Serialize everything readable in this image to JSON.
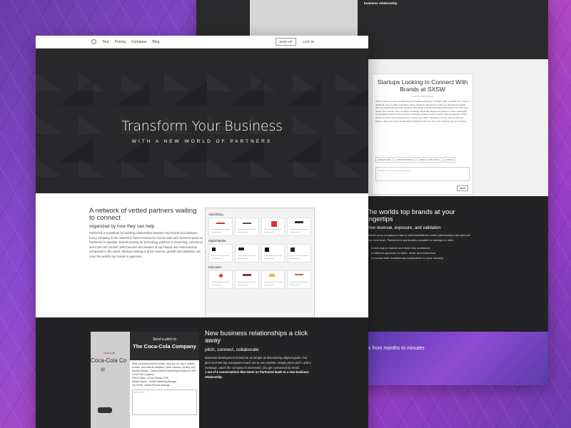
{
  "nav": {
    "items": [
      "Tour",
      "Pricing",
      "Company",
      "Blog"
    ],
    "signup": "SIGN UP",
    "login": "LOG IN"
  },
  "hero": {
    "title": "Transform Your Business",
    "subtitle": "WITH A NEW WORLD OF PARTNERS"
  },
  "network": {
    "heading": "A network of vetted partners waiting to connect",
    "sub": "organized by how they can help",
    "body": "Partnered is a platform for building relationships between top brands and startups. Every company in the network is hand reviewed to ensure that each moment spent on Partnered is valuable. Brands looking for technology partners in marketing, commerce and more can connect with founders and leaders of top funded and vetted startup companies in the world. Startups looking to drive revenue, growth and validation can meet the world's top brands & agencies.",
    "categories": [
      "Advertising",
      "Digital Media",
      "Education"
    ]
  },
  "pitch": {
    "send": "Send a pitch to",
    "company": "The Coca-Cola Company",
    "back_name": "Coca-Cola Co",
    "options": [
      "Most successful pitches include: what you do, why it matters to them, and external validation (other partners, funding, etc)",
      "Rachel Dawson - Global Director Marketing Innovation & The Coca-Cola Company",
      "Peter Collins - Group Director CPE",
      "Natalie Nunez - Global Marketing Manager",
      "Jim White - Global Product Strategy"
    ],
    "placeholder": "Enter here..."
  },
  "biz": {
    "heading": "New business relationships a click away",
    "sub": "pitch, connect, collaborate",
    "body1": "Business development should be as simple as discovering aligned goals. Our pitch tool lets top companies reach out to one another. Simply press pitch, add a message, and if the company is interested, you get connected by email.",
    "body2": "1 out of 4 conversations that starts on Partnered leads to a new business relationship."
  },
  "back": {
    "relationship": "business relationship.",
    "post_title": "Startups Looking to Connect With Brands at SXSW",
    "posted_by": "posted by PARTNERED",
    "post_body": "We're hosting our first ever Partnered \"innovation exchange\" on March 13th at SXSW. The event is designed to be an offline extension of the network in that we'll be setting up structured meetings with top brands and agencies based on their goals. Instead of throwing 300 people in a room and hoping they connect, the innovation exchange will enable aligned companies to have meaningful conversations based on the premise of actually working together. Early confirmed guests include groups of senior level executives from Coca-Cola, GMO, Mondelez, L'Oreal, and Leo Burnett. Reply to this post if you'll be attending SXSW and we'll see how your company can get involved.",
    "tags": [
      "ADVERTISING",
      "ENTERTAINMENT",
      "MEDIA & PUBLISHING",
      "MOBILE"
    ],
    "reply_placeholder": "Explain how we can work together...",
    "send": "SEND",
    "brands_heading": "The worlds top brands at your fingertips",
    "brands_sub": "Drive revenue, exposure, and validation",
    "brands_body": "Whether your company is new or well-established, brand partnerships can take you to the next level. Partnered is particularly valuable for startups to offer:",
    "bullets": [
      "A new way to market and reach key audiences",
      "A different approach to sales, retail, and commerce",
      "A product with revolutionary implications for your industry"
    ],
    "purple_text": "s from months to minutes"
  }
}
